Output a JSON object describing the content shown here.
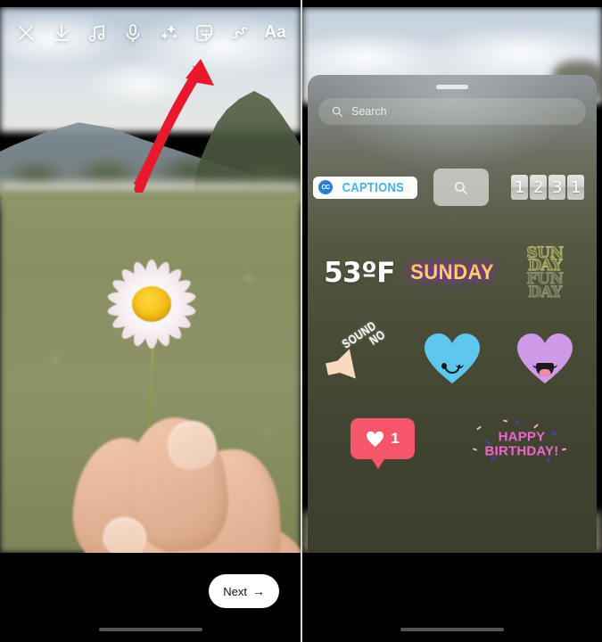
{
  "left_panel": {
    "name": "instagram-story-editor",
    "toolbar": [
      {
        "icon": "close-icon",
        "label": "Close"
      },
      {
        "icon": "download-icon",
        "label": "Save"
      },
      {
        "icon": "music-note-icon",
        "label": "Music"
      },
      {
        "icon": "microphone-icon",
        "label": "Voice"
      },
      {
        "icon": "sparkles-icon",
        "label": "Effects"
      },
      {
        "icon": "sticker-icon",
        "label": "Stickers"
      },
      {
        "icon": "draw-squiggle-icon",
        "label": "Draw"
      },
      {
        "icon": "text-aa-icon",
        "label": "Aa"
      }
    ],
    "photo_description": "Close-up of a hand holding a white daisy flower in a grassy field with blurred mountains",
    "next_button": {
      "label": "Next",
      "arrow": "→"
    },
    "annotation_arrow": {
      "color": "#e8192c",
      "points_to": "sticker-icon"
    }
  },
  "right_panel": {
    "name": "sticker-tray-sheet",
    "search": {
      "placeholder": "Search",
      "icon": "search-icon"
    },
    "annotation_arrow": {
      "color": "#e8192c",
      "points_to": "captions-sticker"
    },
    "sticker_rows": [
      [
        {
          "id": "captions",
          "type": "captions",
          "badge": "CC",
          "label": "CAPTIONS",
          "text_color": "#43b4e4",
          "bg": "#fdfdfd"
        },
        {
          "id": "search-tile",
          "type": "search-tile",
          "icon": "search-icon"
        },
        {
          "id": "countdown",
          "type": "countdown",
          "digits": [
            "1",
            "2",
            "3",
            "1"
          ]
        }
      ],
      [
        {
          "id": "temperature",
          "type": "temperature",
          "label": "53ºF"
        },
        {
          "id": "weekday",
          "type": "weekday",
          "label": "SUNDAY"
        },
        {
          "id": "sunday-fun-day",
          "type": "outline-stack",
          "lines": [
            "SUN",
            "DAY",
            "FUN",
            "DAY"
          ]
        }
      ],
      [
        {
          "id": "sound-on",
          "type": "sound-on",
          "line1": "SOUND",
          "line2": "ON"
        },
        {
          "id": "heart-blue",
          "type": "heart",
          "color": "#5ec7ef",
          "face": "wink-smile"
        },
        {
          "id": "heart-purple",
          "type": "heart",
          "color": "#cf9ae8",
          "face": "open-laugh"
        }
      ],
      [
        {
          "id": "like-bubble",
          "type": "like-bubble",
          "count": "1",
          "color": "#f5566a"
        },
        {
          "id": "happy-birthday",
          "type": "birthday",
          "line1": "HAPPY",
          "line2": "BIRTHDAY!",
          "color": "#e86bc6"
        }
      ]
    ]
  },
  "colors": {
    "arrow_red": "#e8192c",
    "captions_blue": "#43b4e4",
    "like_red": "#f5566a",
    "heart_blue": "#5ec7ef",
    "heart_purple": "#cf9ae8",
    "birthday_pink": "#e86bc6"
  }
}
